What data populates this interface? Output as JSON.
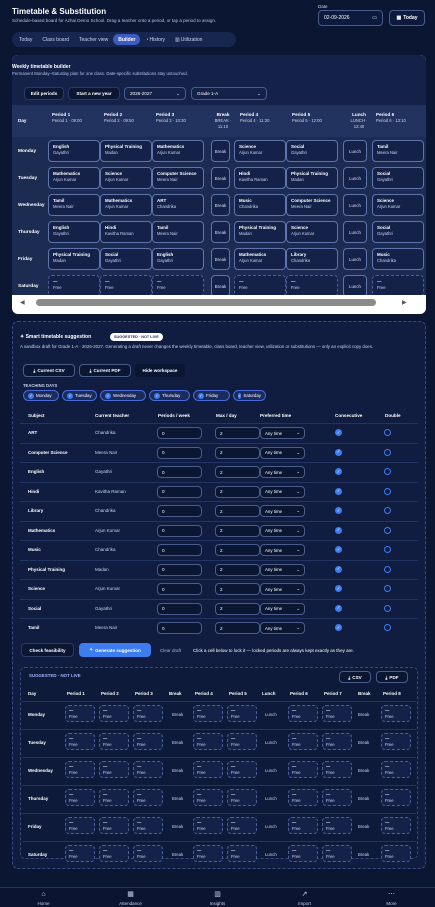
{
  "header": {
    "title": "Timetable & Substitution",
    "subtitle": "Schedule-based board for Azhai Demo School. Drag a teacher onto a period, or tap a period to assign.",
    "date_label": "Date",
    "date_value": "02-09-2026",
    "today_label": "Today"
  },
  "tabs": [
    "Today",
    "Class board",
    "Teacher view",
    "Builder",
    "History",
    "Utilization"
  ],
  "active_tab": "Builder",
  "builder": {
    "title": "Weekly timetable builder",
    "subtitle": "Permanent Monday–Saturday plan for one class. Date-specific substitutions stay untouched.",
    "edit_label": "Edit periods",
    "new_year_label": "Start a new year",
    "year": "2026-2027",
    "grade": "Grade 1-A",
    "columns": [
      {
        "t": "Period 1",
        "s": "Period 1 · 09:00"
      },
      {
        "t": "Period 2",
        "s": "Period 2 · 09:50"
      },
      {
        "t": "Period 3",
        "s": "Period 3 · 10:30"
      },
      {
        "t": "Break",
        "s": "BREAK · 11:10"
      },
      {
        "t": "Period 4",
        "s": "Period 4 · 11:20"
      },
      {
        "t": "Period 5",
        "s": "Period 5 · 12:00"
      },
      {
        "t": "Lunch",
        "s": "LUNCH · 12:40"
      },
      {
        "t": "Period 6",
        "s": "Period 6 · 13:10"
      }
    ],
    "day_header": "Day",
    "break_label": "Break",
    "lunch_label": "Lunch",
    "rows": [
      {
        "day": "Monday",
        "cells": [
          [
            "English",
            "Gayathri"
          ],
          [
            "Physical Training",
            "Madan"
          ],
          [
            "Mathematics",
            "Arjun Kumar"
          ],
          [
            "Science",
            "Arjun Kumar"
          ],
          [
            "Social",
            "Gayathri"
          ],
          [
            "Tamil",
            "Meera Nair"
          ]
        ]
      },
      {
        "day": "Tuesday",
        "cells": [
          [
            "Mathematics",
            "Arjun Kumar"
          ],
          [
            "Science",
            "Arjun Kumar"
          ],
          [
            "Computer Science",
            "Meera Nair"
          ],
          [
            "Hindi",
            "Kavitha Raman"
          ],
          [
            "Physical Training",
            "Madan"
          ],
          [
            "Social",
            "Gayathri"
          ]
        ]
      },
      {
        "day": "Wednesday",
        "cells": [
          [
            "Tamil",
            "Meera Nair"
          ],
          [
            "Mathematics",
            "Arjun Kumar"
          ],
          [
            "ART",
            "Chandrika"
          ],
          [
            "Music",
            "Chandrika"
          ],
          [
            "Computer Science",
            "Meera Nair"
          ],
          [
            "Science",
            "Arjun Kumar"
          ]
        ]
      },
      {
        "day": "Thursday",
        "cells": [
          [
            "English",
            "Gayathri"
          ],
          [
            "Hindi",
            "Kavitha Raman"
          ],
          [
            "Tamil",
            "Meera Nair"
          ],
          [
            "Physical Training",
            "Madan"
          ],
          [
            "Science",
            "Arjun Kumar"
          ],
          [
            "Social",
            "Gayathri"
          ]
        ]
      },
      {
        "day": "Friday",
        "cells": [
          [
            "Physical Training",
            "Madan"
          ],
          [
            "Social",
            "Gayathri"
          ],
          [
            "English",
            "Gayathri"
          ],
          [
            "Mathematics",
            "Arjun Kumar"
          ],
          [
            "Library",
            "Chandrika"
          ],
          [
            "Music",
            "Chandrika"
          ]
        ]
      },
      {
        "day": "Saturday",
        "cells": [
          [
            "—",
            "Free"
          ],
          [
            "—",
            "Free"
          ],
          [
            "—",
            "Free"
          ],
          [
            "—",
            "Free"
          ],
          [
            "—",
            "Free"
          ],
          [
            "—",
            "Free"
          ]
        ]
      }
    ]
  },
  "suggestion": {
    "title": "Smart timetable suggestion",
    "badge": "SUGGESTED · NOT LIVE",
    "desc": "A sandbox draft for Grade 1-A · 2026-2027. Generating a draft never changes the weekly timetable, class board, teacher view, utilization or substitutions — only an explicit copy does.",
    "csv_label": "Current CSV",
    "pdf_label": "Current PDF",
    "hide_label": "Hide workspace",
    "teaching_days_label": "TEACHING DAYS",
    "days": [
      "Monday",
      "Tuesday",
      "Wednesday",
      "Thursday",
      "Friday",
      "Saturday"
    ],
    "headers": [
      "Subject",
      "Current teacher",
      "Periods / week",
      "Max / day",
      "Preferred time",
      "Consecutive",
      "Double"
    ],
    "subjects": [
      [
        "ART",
        "Chandrika",
        "0",
        "2",
        "Any time"
      ],
      [
        "Computer Science",
        "Meera Nair",
        "0",
        "2",
        "Any time"
      ],
      [
        "English",
        "Gayathri",
        "0",
        "2",
        "Any time"
      ],
      [
        "Hindi",
        "Kavitha Raman",
        "0",
        "2",
        "Any time"
      ],
      [
        "Library",
        "Chandrika",
        "0",
        "2",
        "Any time"
      ],
      [
        "Mathematics",
        "Arjun Kumar",
        "0",
        "2",
        "Any time"
      ],
      [
        "Music",
        "Chandrika",
        "0",
        "2",
        "Any time"
      ],
      [
        "Physical Training",
        "Madan",
        "0",
        "2",
        "Any time"
      ],
      [
        "Science",
        "Arjun Kumar",
        "0",
        "2",
        "Any time"
      ],
      [
        "Social",
        "Gayathri",
        "0",
        "2",
        "Any time"
      ],
      [
        "Tamil",
        "Meera Nair",
        "0",
        "2",
        "Any time"
      ]
    ],
    "feasibility_label": "Check feasibility",
    "generate_label": "Generate suggestion",
    "clear_label": "Clear draft",
    "hint": "Click a cell below to lock it — locked periods are always kept exactly as they are."
  },
  "draft": {
    "tag": "SUGGESTED · NOT LIVE",
    "csv": "CSV",
    "pdf": "PDF",
    "headers": [
      "Day",
      "Period 1",
      "Period 2",
      "Period 3",
      "Break",
      "Period 4",
      "Period 5",
      "Lunch",
      "Period 6",
      "Period 7",
      "Break",
      "Period 8"
    ],
    "days": [
      "Monday",
      "Tuesday",
      "Wednesday",
      "Thursday",
      "Friday",
      "Saturday"
    ],
    "dash": "—",
    "free": "Free",
    "break_label": "Break",
    "lunch_label": "Lunch"
  },
  "nav": [
    "Home",
    "Attendance",
    "Insights",
    "Import",
    "More"
  ]
}
